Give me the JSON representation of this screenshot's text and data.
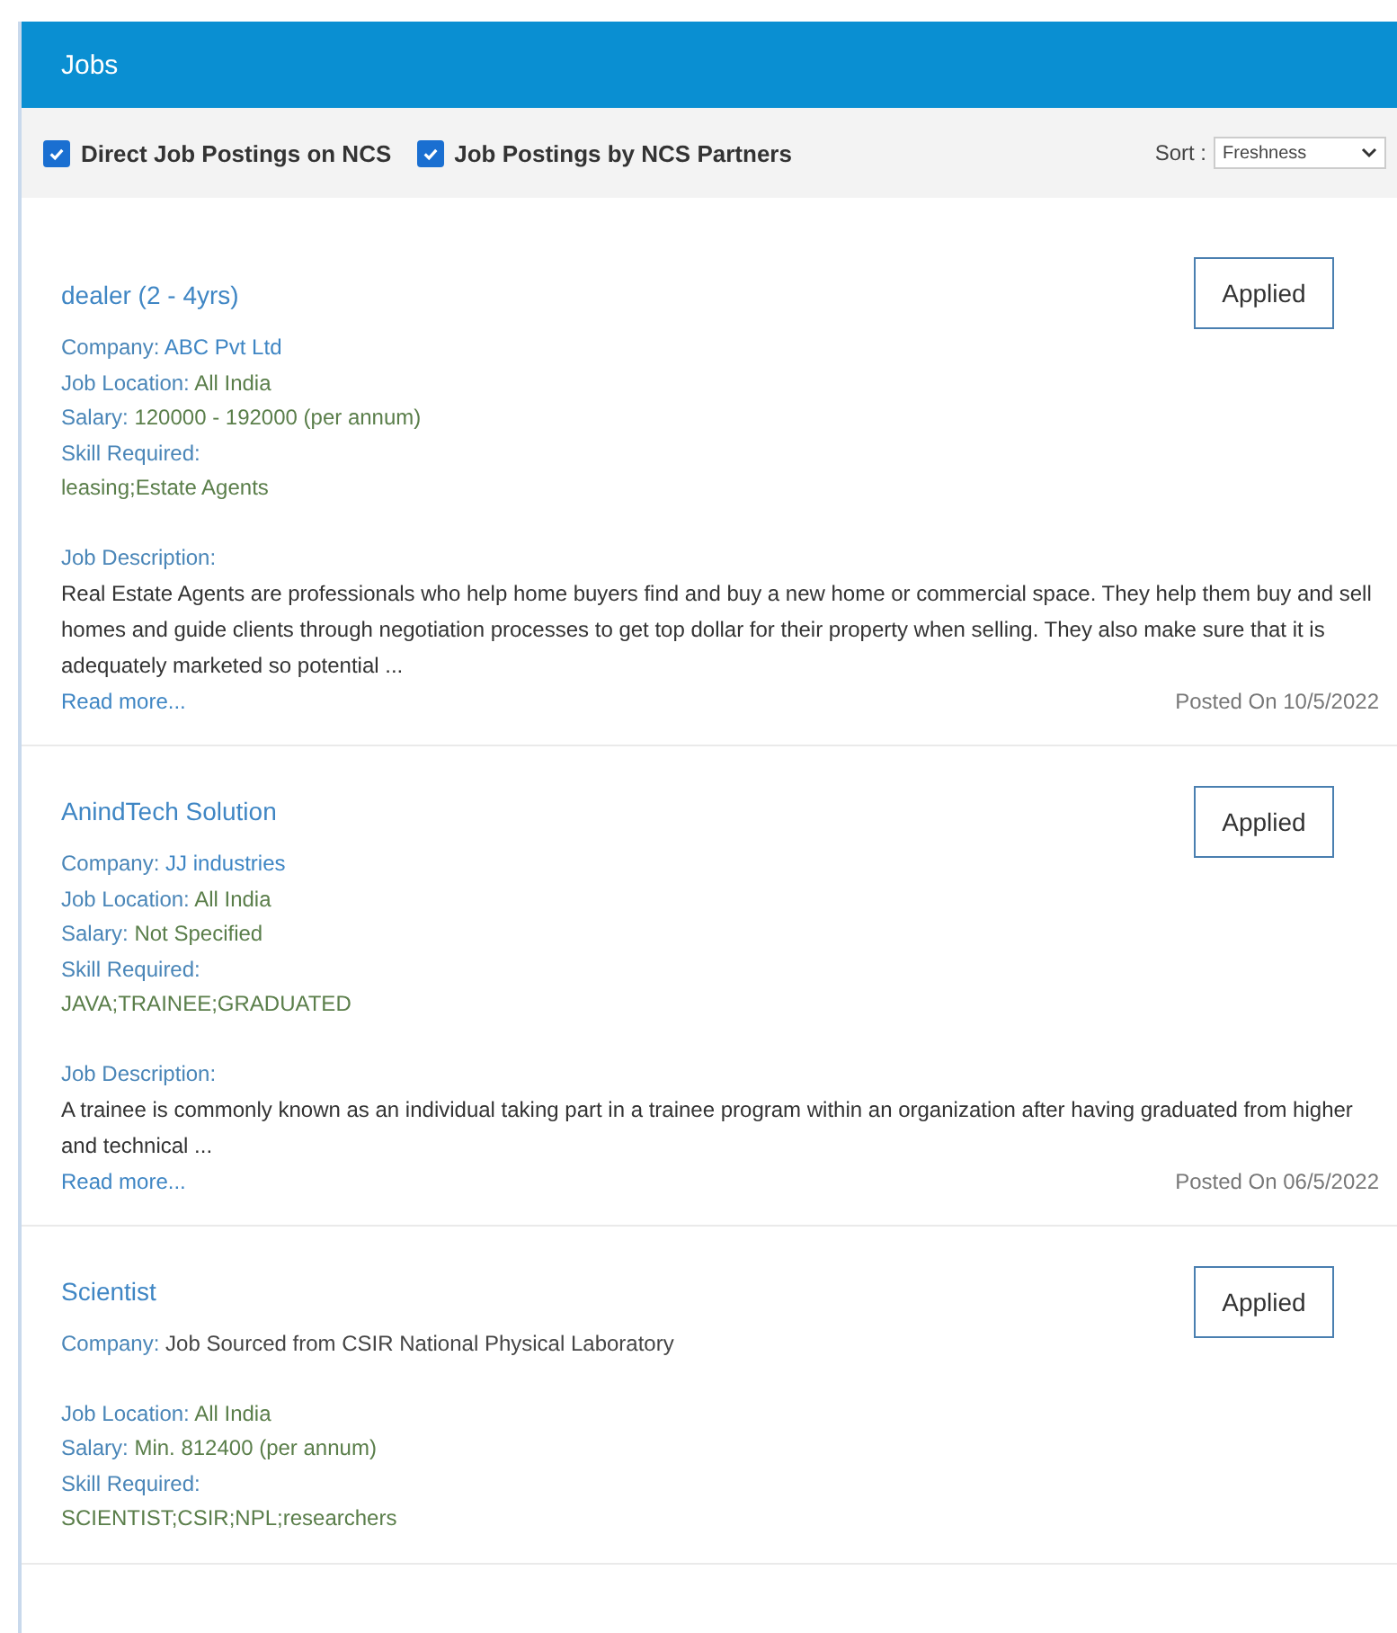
{
  "header": {
    "title": "Jobs"
  },
  "filters": [
    {
      "label": "Direct Job Postings on NCS",
      "checked": true
    },
    {
      "label": "Job Postings by NCS Partners",
      "checked": true
    }
  ],
  "sort": {
    "label": "Sort :",
    "value": "Freshness"
  },
  "jobs": [
    {
      "title": "dealer (2 - 4yrs)",
      "button": "Applied",
      "company_label": "Company:",
      "company": "ABC Pvt Ltd",
      "company_linked": true,
      "location_label": "Job Location:",
      "location": "All India",
      "salary_label": "Salary:",
      "salary": "120000 - 192000 (per annum)",
      "skills_label": "Skill Required:",
      "skills": "leasing;Estate Agents",
      "description_label": "Job Description:",
      "description": "Real Estate Agents are professionals who help home buyers find and buy a new home or commercial space. They help them buy and sell homes and guide clients through negotiation processes to get top dollar for their property when selling. They also make sure that it is adequately marketed so potential ...",
      "read_more": "Read more...",
      "posted": "Posted On 10/5/2022"
    },
    {
      "title": "AnindTech Solution",
      "button": "Applied",
      "company_label": "Company:",
      "company": "JJ industries",
      "company_linked": true,
      "location_label": "Job Location:",
      "location": "All India",
      "salary_label": "Salary:",
      "salary": "Not Specified",
      "skills_label": "Skill Required:",
      "skills": "JAVA;TRAINEE;GRADUATED",
      "description_label": "Job Description:",
      "description": "A trainee is commonly known as an individual taking part in a trainee program within an organization after having graduated from higher and technical ...",
      "read_more": "Read more...",
      "posted": "Posted On 06/5/2022"
    },
    {
      "title": "Scientist",
      "button": "Applied",
      "company_label": "Company:",
      "company": "Job Sourced from CSIR National Physical Laboratory",
      "company_linked": false,
      "location_label": "Job Location:",
      "location": "All India",
      "salary_label": "Salary:",
      "salary": "Min. 812400 (per annum)",
      "skills_label": "Skill Required:",
      "skills": "SCIENTIST;CSIR;NPL;researchers"
    }
  ]
}
